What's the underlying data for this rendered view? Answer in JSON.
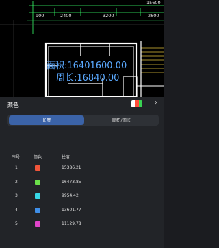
{
  "cad": {
    "dimensions": {
      "top_right": "15600",
      "d1": "900",
      "d2": "2400",
      "d3": "3200",
      "d4": "2600"
    },
    "area_text": "面积:16401600.00",
    "perimeter_text": "周长:16840.00"
  },
  "panel": {
    "title": "颜色",
    "preview_colors": [
      "#ffffff",
      "#ff4d3a",
      "#39d353"
    ],
    "tabs": [
      {
        "label": "长度",
        "active": true
      },
      {
        "label": "面积/周长",
        "active": false
      }
    ],
    "columns": [
      "序号",
      "颜色",
      "长度"
    ],
    "rows": [
      {
        "index": "1",
        "color": "#f0553a",
        "length": "15386.21"
      },
      {
        "index": "2",
        "color": "#6be04a",
        "length": "16473.85"
      },
      {
        "index": "3",
        "color": "#37d7e6",
        "length": "9954.42"
      },
      {
        "index": "4",
        "color": "#3f8fe8",
        "length": "13601.77"
      },
      {
        "index": "5",
        "color": "#e044c9",
        "length": "11129.78"
      }
    ]
  }
}
